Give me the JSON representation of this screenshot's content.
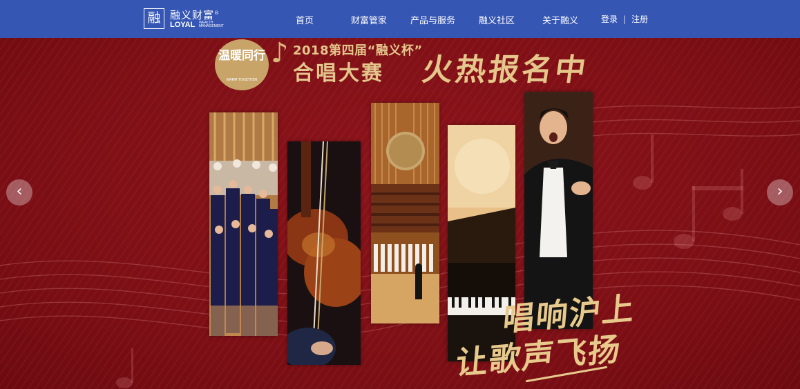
{
  "header": {
    "logo_mark": "融",
    "logo_cn": "融义财富",
    "logo_reg": "®",
    "logo_en": "LOYAL",
    "logo_sub": "WEALTH MANAGEMENT",
    "nav": [
      "首页",
      "财富管家",
      "产品与服务",
      "融义社区",
      "关于融义"
    ],
    "login": "登录",
    "separator": "|",
    "register": "注册"
  },
  "banner": {
    "badge_title": "温暖同行",
    "badge_sub": "WARM TOGETHER",
    "title_line1": "2018第四届“融义杯”",
    "title_line2": "合唱大赛",
    "slogan": "火热报名中",
    "calligraphy_line1": "唱响沪上",
    "calligraphy_line2": "让歌声飞扬",
    "prev_arrow": "‹",
    "next_arrow": "›"
  },
  "colors": {
    "header_bg": "#3656b4",
    "banner_bg": "#7e0f14",
    "gold": "#e4c68c"
  }
}
